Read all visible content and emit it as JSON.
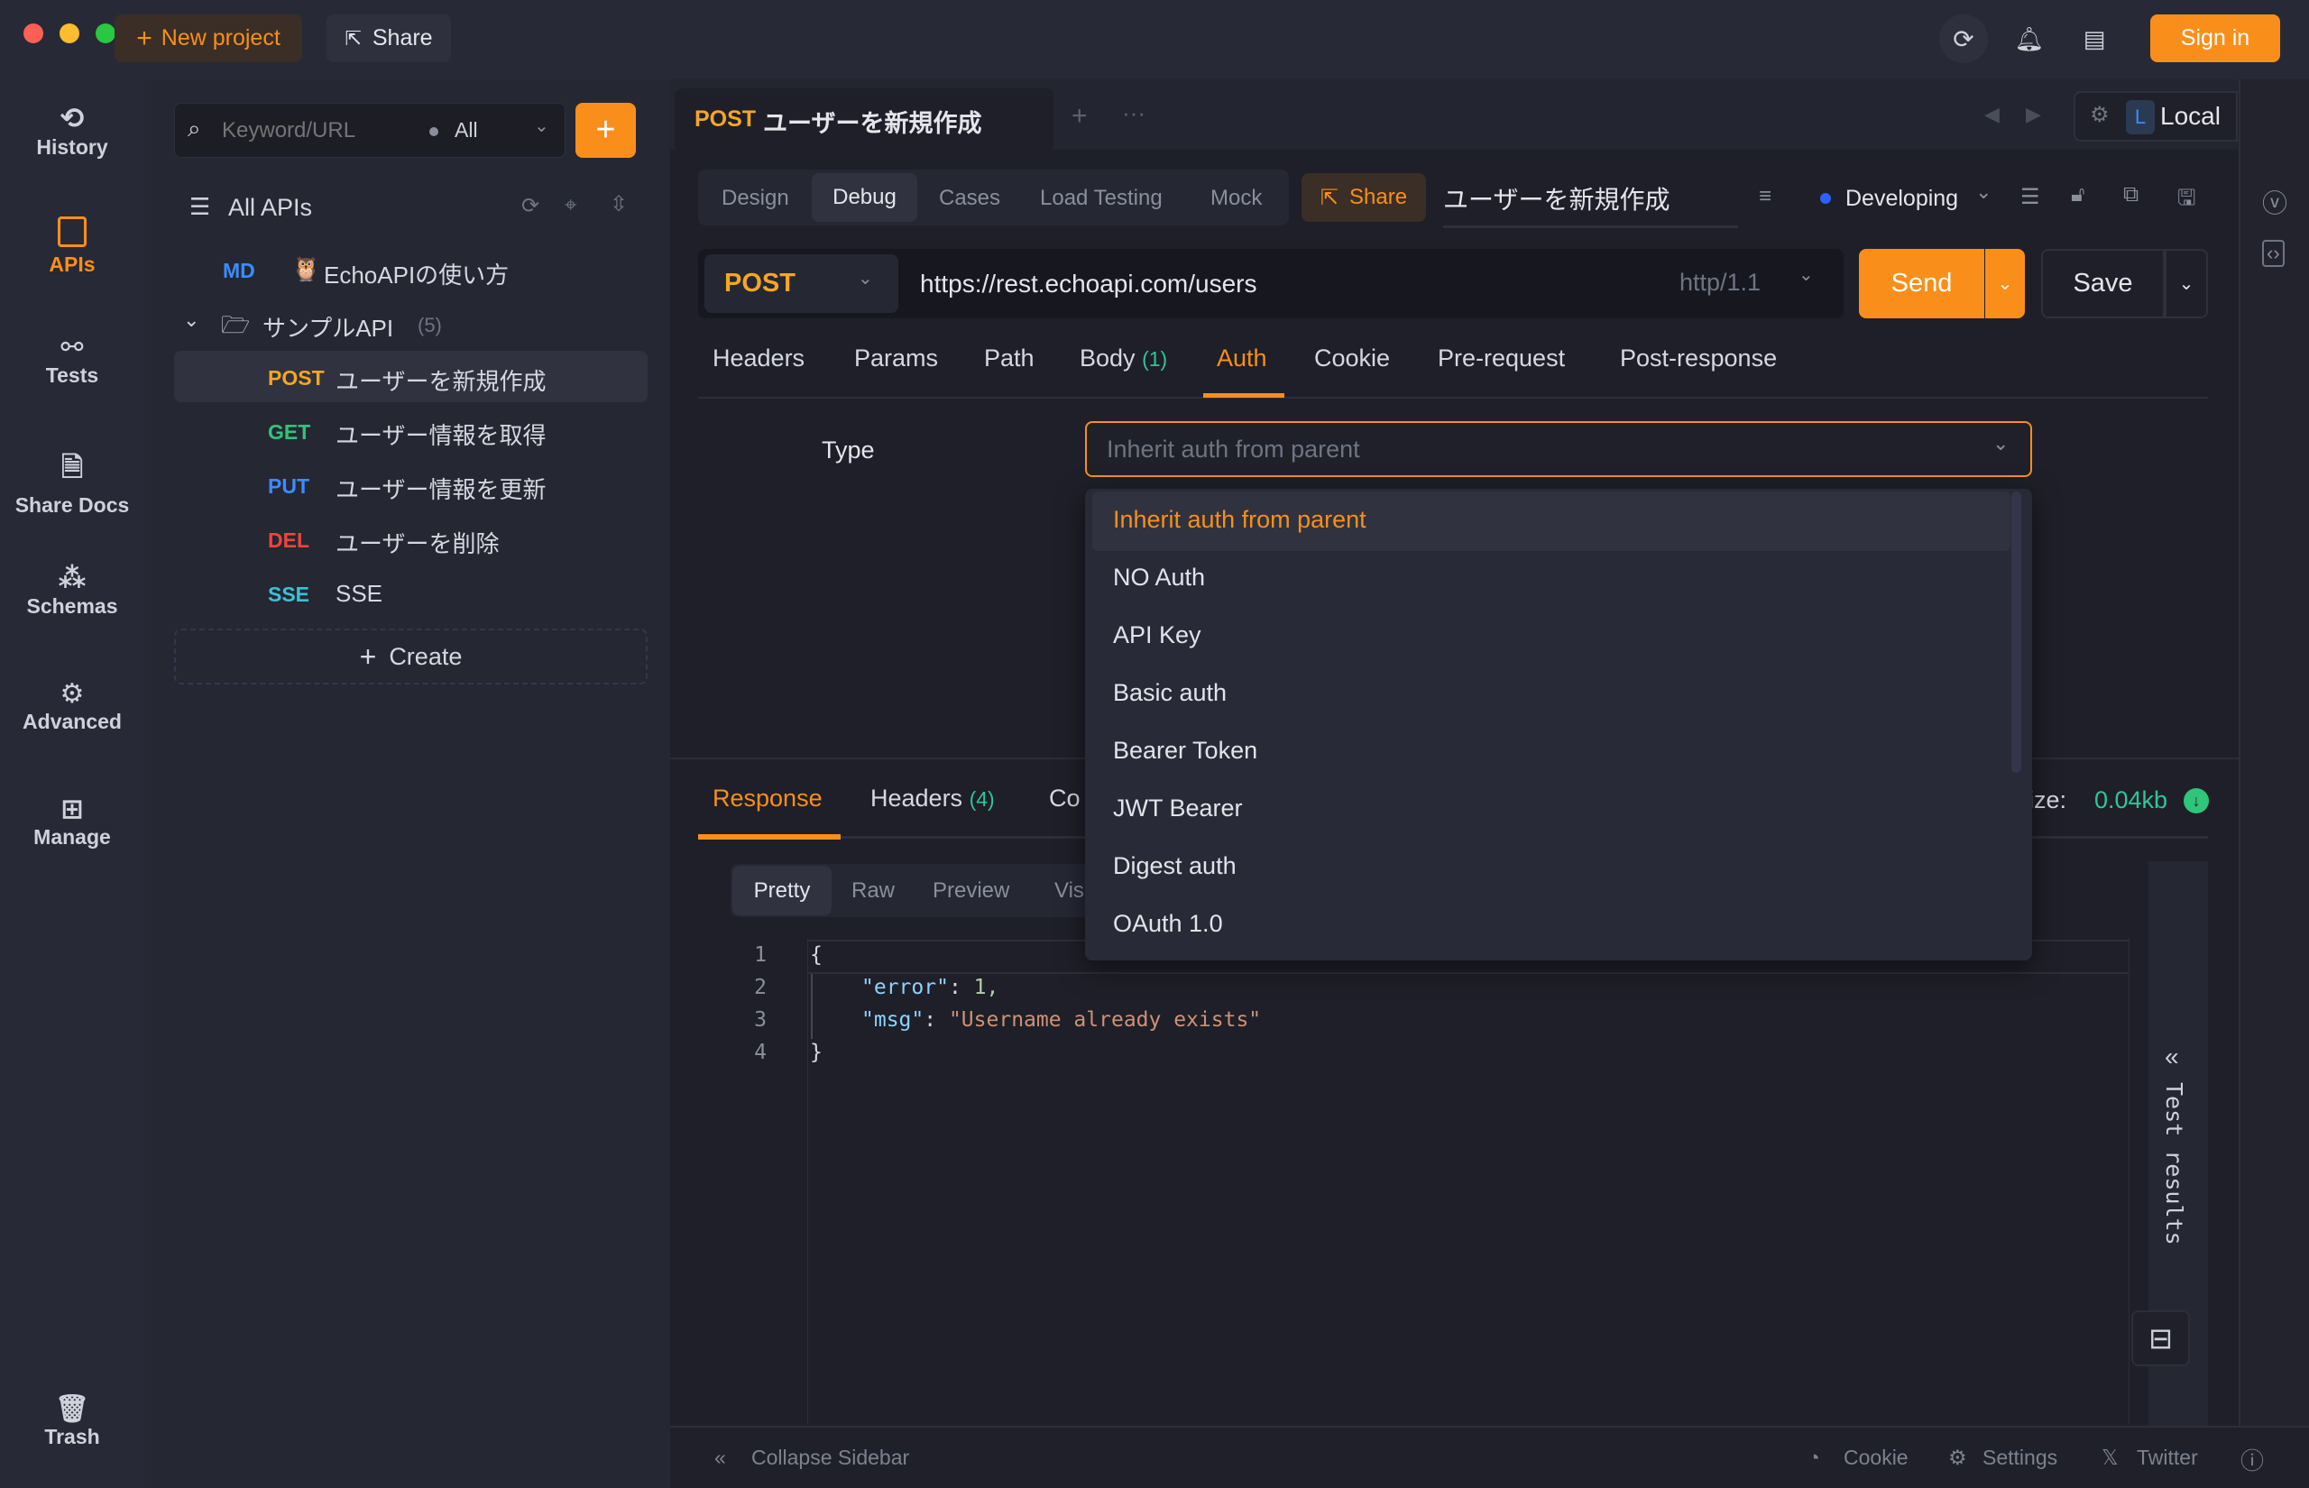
{
  "titlebar": {
    "new_project": "New project",
    "share": "Share",
    "sign_in": "Sign in"
  },
  "rail": {
    "items": [
      {
        "label": "History",
        "icon": "history-icon"
      },
      {
        "label": "APIs",
        "icon": "apis-icon",
        "active": true
      },
      {
        "label": "Tests",
        "icon": "tests-icon"
      },
      {
        "label": "Share Docs",
        "icon": "share-docs-icon"
      },
      {
        "label": "Schemas",
        "icon": "schemas-icon"
      },
      {
        "label": "Advanced",
        "icon": "advanced-icon"
      },
      {
        "label": "Manage",
        "icon": "manage-icon"
      }
    ],
    "trash": "Trash"
  },
  "sidebar": {
    "search_placeholder": "Keyword/URL",
    "filter": "All",
    "all_apis": "All APIs",
    "md": {
      "method": "MD",
      "name": "EchoAPIの使い方"
    },
    "folder": {
      "name": "サンプルAPI",
      "count": "(5)"
    },
    "items": [
      {
        "method": "POST",
        "name": "ユーザーを新規作成",
        "color": "#f5a623"
      },
      {
        "method": "GET",
        "name": "ユーザー情報を取得",
        "color": "#2fc57a"
      },
      {
        "method": "PUT",
        "name": "ユーザー情報を更新",
        "color": "#3b8cff"
      },
      {
        "method": "DEL",
        "name": "ユーザーを削除",
        "color": "#f0443c"
      },
      {
        "method": "SSE",
        "name": "SSE",
        "color": "#3fbfd8"
      }
    ],
    "create": "Create"
  },
  "tab": {
    "method": "POST",
    "title": "ユーザーを新規作成"
  },
  "env": {
    "badge": "L",
    "name": "Local"
  },
  "modes": [
    "Design",
    "Debug",
    "Cases",
    "Load Testing",
    "Mock"
  ],
  "active_mode": "Debug",
  "share": "Share",
  "api_name": "ユーザーを新規作成",
  "status": "Developing",
  "request": {
    "method": "POST",
    "url": "https://rest.echoapi.com/users",
    "protocol": "http/1.1",
    "send": "Send",
    "save": "Save"
  },
  "req_tabs": [
    {
      "label": "Headers"
    },
    {
      "label": "Params"
    },
    {
      "label": "Path"
    },
    {
      "label": "Body",
      "count": "(1)"
    },
    {
      "label": "Auth",
      "active": true
    },
    {
      "label": "Cookie"
    },
    {
      "label": "Pre-request"
    },
    {
      "label": "Post-response"
    }
  ],
  "auth": {
    "type_label": "Type",
    "selected": "Inherit auth from parent",
    "options": [
      "Inherit auth from parent",
      "NO Auth",
      "API Key",
      "Basic auth",
      "Bearer Token",
      "JWT Bearer",
      "Digest auth",
      "OAuth 1.0"
    ]
  },
  "response": {
    "tabs": [
      {
        "label": "Response"
      },
      {
        "label": "Headers",
        "count": "(4)"
      },
      {
        "label": "Co"
      }
    ],
    "size_label": "ize:",
    "size": "0.04kb",
    "views": [
      "Pretty",
      "Raw",
      "Preview",
      "Vis"
    ],
    "lines": [
      {
        "n": "1"
      },
      {
        "n": "2",
        "key": "\"error\"",
        "val": "1,"
      },
      {
        "n": "3",
        "key": "\"msg\"",
        "val": "\"Username already exists\""
      },
      {
        "n": "4"
      }
    ],
    "open_brace": "{",
    "close_brace": "}",
    "colon": ": ",
    "test_results": "Test results"
  },
  "footer": {
    "collapse": "Collapse Sidebar",
    "cookie": "Cookie",
    "settings": "Settings",
    "twitter": "Twitter"
  },
  "colors": {
    "accent": "#f98f1a",
    "bg": "#1e1f28",
    "panel": "#272a36"
  }
}
